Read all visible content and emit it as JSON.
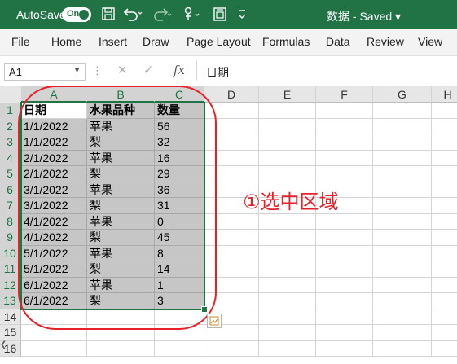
{
  "titlebar": {
    "autosave_label": "AutoSave",
    "autosave_toggle": "On",
    "document_title": "数据 - Saved ▾",
    "accent": "#217346"
  },
  "menu": [
    "File",
    "Home",
    "Insert",
    "Draw",
    "Page Layout",
    "Formulas",
    "Data",
    "Review",
    "View"
  ],
  "formula_bar": {
    "name_box": "A1",
    "fx": "fx",
    "content": "日期"
  },
  "columns": [
    "A",
    "B",
    "C",
    "D",
    "E",
    "F",
    "G",
    "H"
  ],
  "rows": [
    "1",
    "2",
    "3",
    "4",
    "5",
    "6",
    "7",
    "8",
    "9",
    "10",
    "11",
    "12",
    "13",
    "14",
    "15",
    "16"
  ],
  "table": {
    "headers": [
      "日期",
      "水果品种",
      "数量"
    ],
    "rows": [
      [
        "1/1/2022",
        "苹果",
        "56"
      ],
      [
        "1/1/2022",
        "梨",
        "32"
      ],
      [
        "2/1/2022",
        "苹果",
        "16"
      ],
      [
        "2/1/2022",
        "梨",
        "29"
      ],
      [
        "3/1/2022",
        "苹果",
        "36"
      ],
      [
        "3/1/2022",
        "梨",
        "31"
      ],
      [
        "4/1/2022",
        "苹果",
        "0"
      ],
      [
        "4/1/2022",
        "梨",
        "45"
      ],
      [
        "5/1/2022",
        "苹果",
        "8"
      ],
      [
        "5/1/2022",
        "梨",
        "14"
      ],
      [
        "6/1/2022",
        "苹果",
        "1"
      ],
      [
        "6/1/2022",
        "梨",
        "3"
      ]
    ]
  },
  "annotation": {
    "text": "①选中区域",
    "color": "#e8202a"
  },
  "icons": [
    "save-icon",
    "undo-icon",
    "redo-icon",
    "touch-mode-icon",
    "form-icon",
    "customize-chevron-icon",
    "quick-analysis-icon"
  ]
}
